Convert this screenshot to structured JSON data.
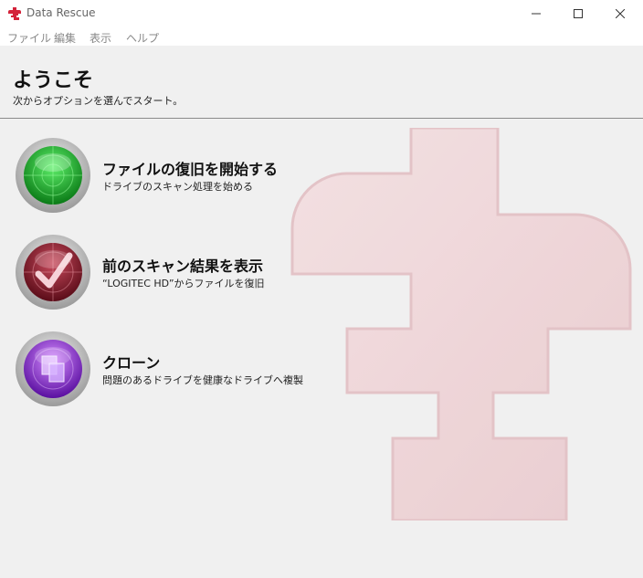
{
  "window": {
    "title": "Data Rescue"
  },
  "menu": [
    "ファイル",
    "編集",
    "表示",
    "ヘルプ"
  ],
  "welcome": {
    "title": "ようこそ",
    "subtitle": "次からオプションを選んでスタート。"
  },
  "options": [
    {
      "title": "ファイルの復旧を開始する",
      "description": "ドライブのスキャン処理を始める",
      "icon": "radar-icon",
      "color": "#1fb52a"
    },
    {
      "title": "前のスキャン結果を表示",
      "description": "“LOGITEC HD”からファイルを復旧",
      "icon": "checkmark-radar-icon",
      "color": "#8c1a2a"
    },
    {
      "title": "クローン",
      "description": "問題のあるドライブを健康なドライブへ複製",
      "icon": "clone-icon",
      "color": "#8a2bd6"
    }
  ],
  "colors": {
    "brand": "#d4233a",
    "watermark": "#e8c8cc"
  }
}
